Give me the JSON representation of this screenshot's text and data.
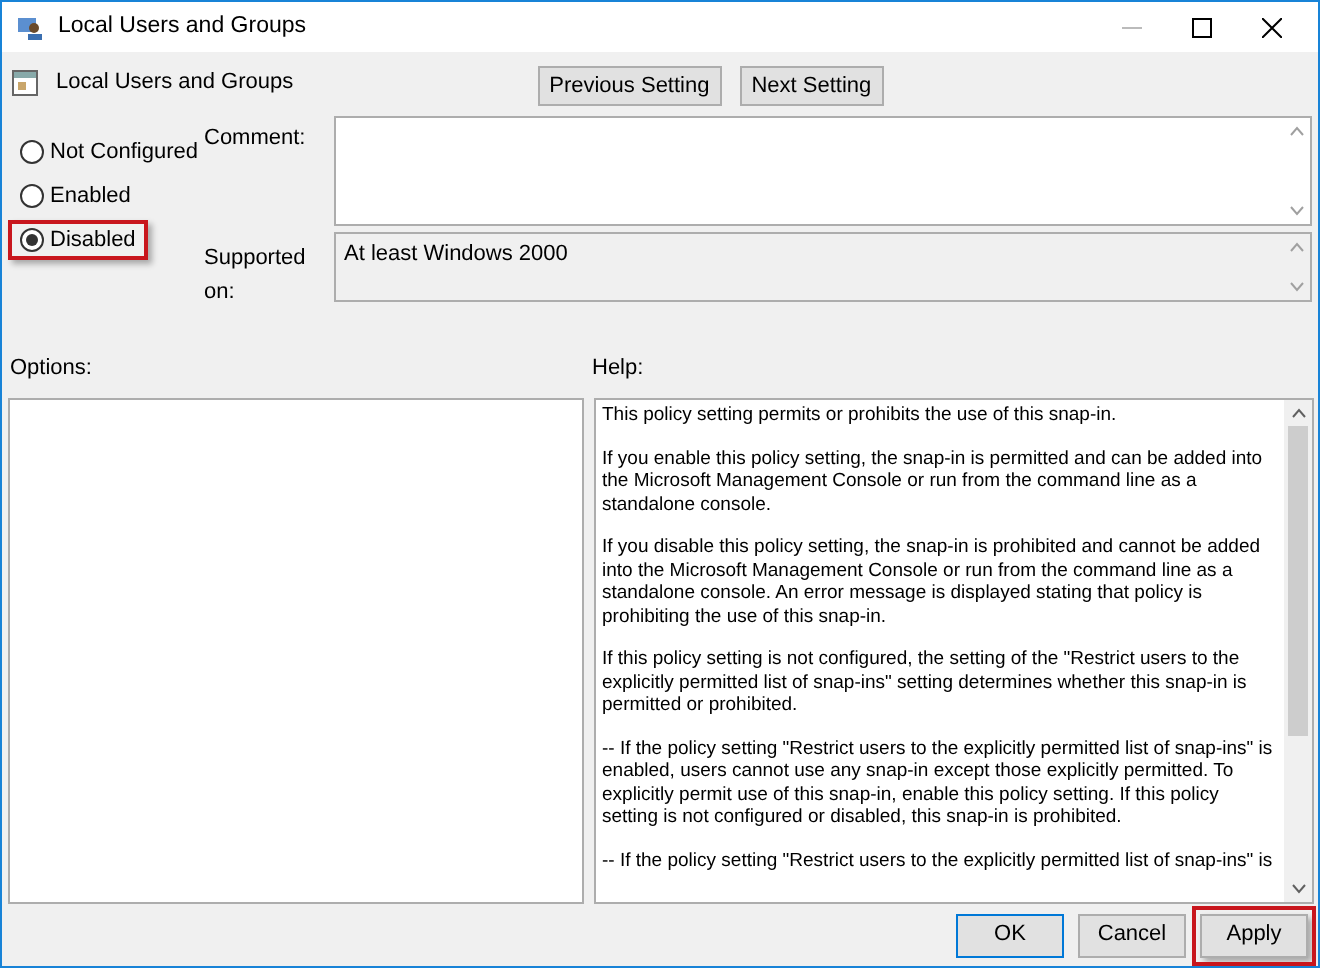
{
  "window": {
    "title": "Local Users and Groups"
  },
  "header": {
    "title": "Local Users and Groups",
    "buttons": [
      "Previous Setting",
      "Next Setting"
    ]
  },
  "state_options": [
    {
      "label": "Not Configured",
      "selected": false,
      "highlighted": false
    },
    {
      "label": "Enabled",
      "selected": false,
      "highlighted": false
    },
    {
      "label": "Disabled",
      "selected": true,
      "highlighted": true
    }
  ],
  "comment": {
    "label": "Comment:"
  },
  "supported_on": {
    "label": "Supported on:",
    "value": "At least Windows 2000"
  },
  "options": {
    "label": "Options:"
  },
  "help": {
    "label": "Help:",
    "paragraphs": [
      "This policy setting permits or prohibits the use of this snap-in.",
      "If you enable this policy setting, the snap-in is permitted and can be added into the Microsoft Management Console or run from the command line as a standalone console.",
      "If you disable this policy setting, the snap-in is prohibited and cannot be added into the Microsoft Management Console or run from the command line as a standalone console. An error message is displayed stating that policy is prohibiting the use of this snap-in.",
      "If this policy setting is not configured, the setting of the \"Restrict users to the explicitly permitted list of snap-ins\" setting determines whether this snap-in is permitted or prohibited.",
      "--  If the policy setting \"Restrict users to the explicitly permitted list of snap-ins\" is enabled, users cannot use any snap-in except those explicitly permitted. To explicitly permit use of this snap-in, enable this policy setting. If this policy setting is not configured or disabled, this snap-in is prohibited.",
      "--  If the policy setting \"Restrict users to the explicitly permitted list of snap-ins\" is"
    ]
  },
  "footer_buttons": [
    {
      "label": "OK",
      "default": true,
      "highlighted": false
    },
    {
      "label": "Cancel",
      "default": false,
      "highlighted": false
    },
    {
      "label": "Apply",
      "default": false,
      "highlighted": true
    }
  ]
}
